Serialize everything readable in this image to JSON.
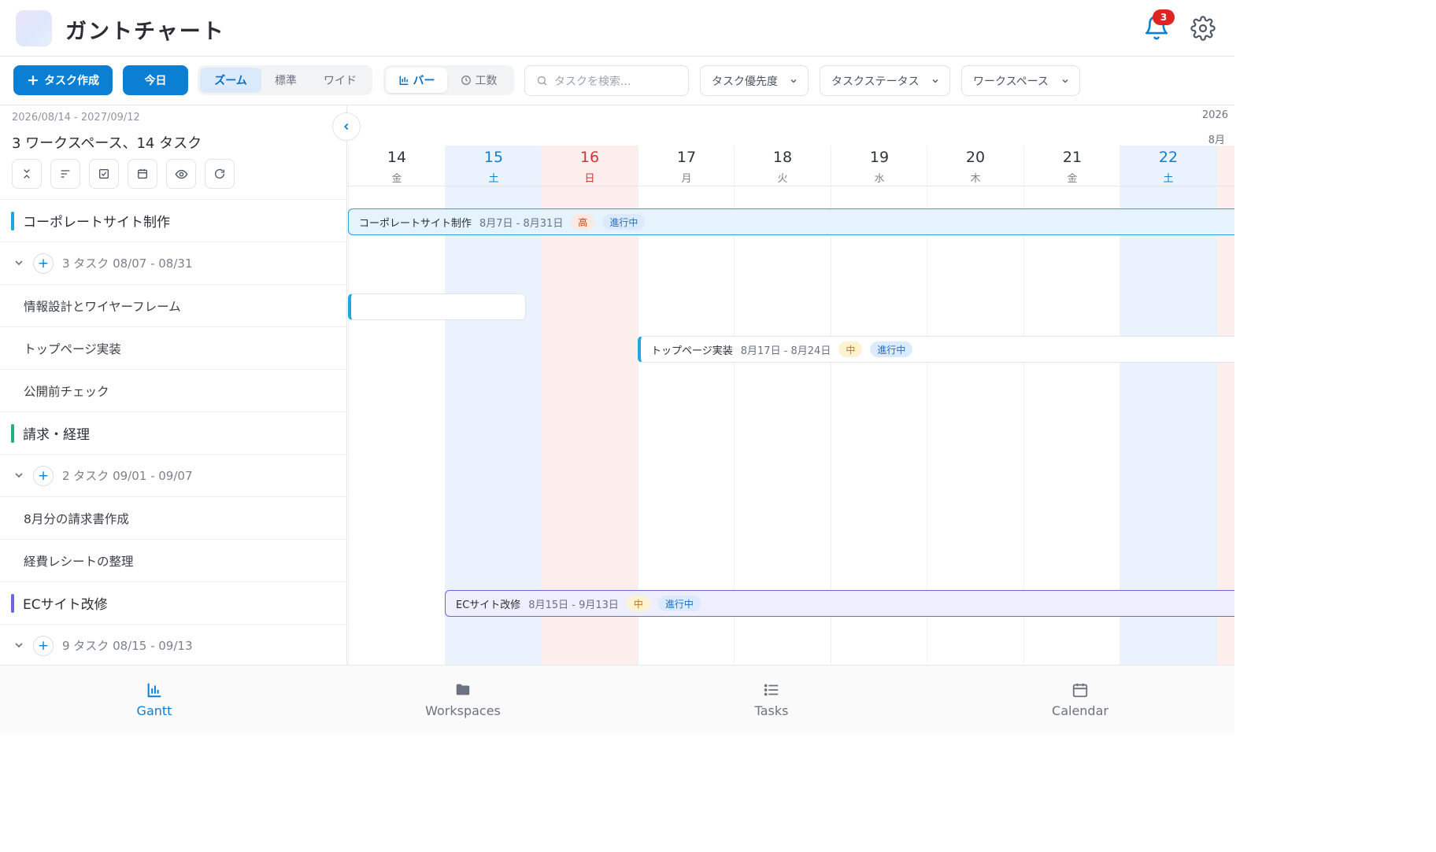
{
  "header": {
    "title": "ガントチャート",
    "notification_count": "3"
  },
  "toolbar": {
    "create_task_label": "タスク作成",
    "today_label": "今日",
    "zoom_options": [
      "ズーム",
      "標準",
      "ワイド"
    ],
    "zoom_selected": "ズーム",
    "view_options": {
      "bar": "バー",
      "effort": "工数"
    },
    "view_selected": "バー",
    "search": {
      "placeholder": "タスクを検索..."
    },
    "filters": [
      "タスク優先度",
      "タスクステータス",
      "ワークスペース"
    ]
  },
  "left_panel": {
    "date_range": "2026/08/14 - 2027/09/12",
    "summary": "3 ワークスペース、14 タスク",
    "icon_buttons": [
      "collapse-all-icon",
      "sort-icon",
      "checkbox-icon",
      "calendar-icon",
      "eye-icon",
      "refresh-icon"
    ],
    "groups": [
      {
        "name": "コーポレートサイト制作",
        "color": "#1ea7e0",
        "meta": "3 タスク 08/07 - 08/31",
        "tasks": [
          "情報設計とワイヤーフレーム",
          "トップページ実装",
          "公開前チェック"
        ]
      },
      {
        "name": "請求・経理",
        "color": "#22b07d",
        "meta": "2 タスク 09/01 - 09/07",
        "tasks": [
          "8月分の請求書作成",
          "経費レシートの整理"
        ]
      },
      {
        "name": "ECサイト改修",
        "color": "#6a67e0",
        "meta": "9 タスク 08/15 - 09/13",
        "tasks": []
      }
    ]
  },
  "timeline": {
    "year": "2026",
    "month": "8月",
    "days": [
      {
        "num": "14",
        "wd": "金",
        "type": "weekday"
      },
      {
        "num": "15",
        "wd": "土",
        "type": "sat"
      },
      {
        "num": "16",
        "wd": "日",
        "type": "sun"
      },
      {
        "num": "17",
        "wd": "月",
        "type": "weekday"
      },
      {
        "num": "18",
        "wd": "火",
        "type": "weekday"
      },
      {
        "num": "19",
        "wd": "水",
        "type": "weekday"
      },
      {
        "num": "20",
        "wd": "木",
        "type": "weekday"
      },
      {
        "num": "21",
        "wd": "金",
        "type": "weekday"
      },
      {
        "num": "22",
        "wd": "土",
        "type": "sat"
      },
      {
        "num": "",
        "wd": "",
        "type": "sun"
      }
    ],
    "bars": [
      {
        "name": "コーポレートサイト制作",
        "dates": "8月7日 - 8月31日",
        "priority": "高",
        "status": "進行中"
      },
      {
        "name": "",
        "dates": "",
        "priority": "",
        "status": ""
      },
      {
        "name": "トップページ実装",
        "dates": "8月17日 - 8月24日",
        "priority": "中",
        "status": "進行中"
      },
      {
        "name": "ECサイト改修",
        "dates": "8月15日 - 9月13日",
        "priority": "中",
        "status": "進行中"
      }
    ]
  },
  "bottom_nav": [
    {
      "label": "Gantt",
      "icon": "bar-chart-icon",
      "active": true
    },
    {
      "label": "Workspaces",
      "icon": "folder-icon",
      "active": false
    },
    {
      "label": "Tasks",
      "icon": "list-icon",
      "active": false
    },
    {
      "label": "Calendar",
      "icon": "calendar-icon",
      "active": false
    }
  ]
}
